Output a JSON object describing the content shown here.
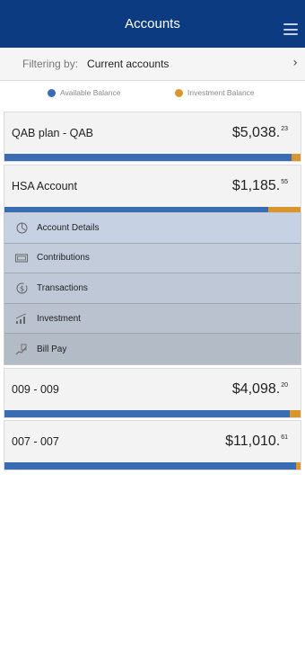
{
  "header": {
    "title": "Accounts",
    "menu_icon": "hamburger-menu-icon"
  },
  "filter": {
    "label": "Filtering by:",
    "value": "Current accounts",
    "chevron_icon": "chevron-right-icon"
  },
  "legend": {
    "available": {
      "label": "Available Balance",
      "color": "#3a6cb3"
    },
    "investment": {
      "label": "Investment Balance",
      "color": "#d8962c"
    }
  },
  "accounts": [
    {
      "name": "QAB plan - QAB",
      "amount_main": "$5,038.",
      "amount_cents": "23",
      "available_fraction": 0.97
    },
    {
      "name": "HSA Account",
      "amount_main": "$1,185.",
      "amount_cents": "55",
      "available_fraction": 0.89
    },
    {
      "name": "009 - 009",
      "amount_main": "$4,098.",
      "amount_cents": "20",
      "available_fraction": 0.965
    },
    {
      "name": "007 - 007",
      "amount_main": "$11,010.",
      "amount_cents": "61",
      "available_fraction": 0.985
    }
  ],
  "submenu": [
    {
      "label": "Account Details",
      "icon": "pie-chart-icon",
      "bg": "#c6d2e3"
    },
    {
      "label": "Contributions",
      "icon": "money-bill-icon",
      "bg": "#c3ccdb"
    },
    {
      "label": "Transactions",
      "icon": "dollar-cycle-icon",
      "bg": "#bfc8d6"
    },
    {
      "label": "Investment",
      "icon": "growth-chart-icon",
      "bg": "#bac2cf"
    },
    {
      "label": "Bill Pay",
      "icon": "bill-pay-icon",
      "bg": "#b3bbc7"
    }
  ]
}
